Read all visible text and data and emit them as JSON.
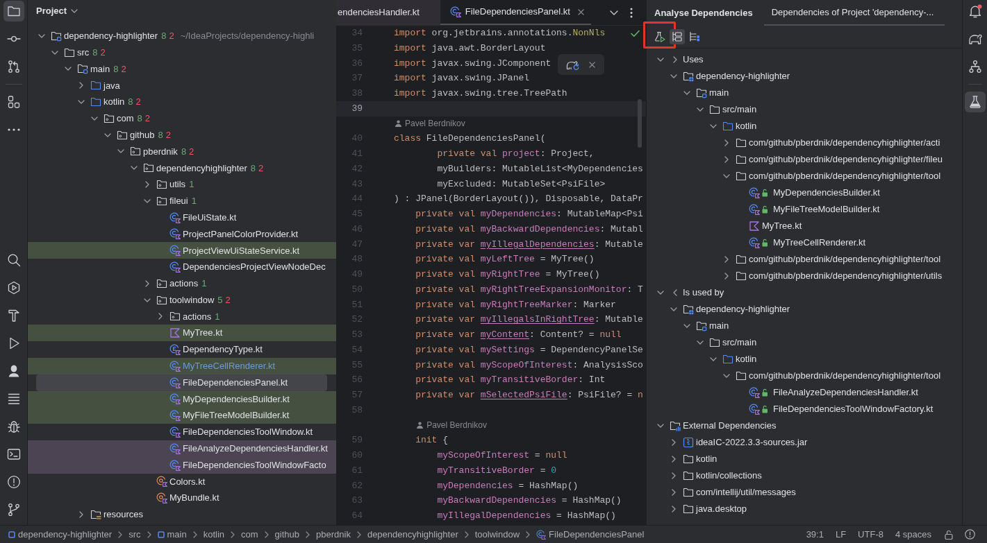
{
  "left_strip": {
    "top_groups": [
      [
        {
          "kind": "project",
          "selected": true
        },
        {
          "kind": "commit",
          "selected": false
        },
        {
          "kind": "pull_requests",
          "selected": false
        }
      ],
      [
        {
          "kind": "structure",
          "selected": false
        },
        {
          "kind": "more",
          "selected": false
        }
      ]
    ],
    "bottom": [
      {
        "kind": "search",
        "selected": false
      },
      {
        "kind": "services",
        "selected": false
      },
      {
        "kind": "build",
        "selected": false
      },
      {
        "kind": "run",
        "selected": false
      },
      {
        "kind": "bust",
        "selected": false
      },
      {
        "kind": "todo",
        "selected": false
      },
      {
        "kind": "debug",
        "selected": false
      },
      {
        "kind": "terminal",
        "selected": false
      },
      {
        "kind": "problems",
        "selected": false
      },
      {
        "kind": "git",
        "selected": false
      }
    ]
  },
  "project_panel": {
    "title": "Project",
    "tree": [
      {
        "label": "dependency-highlighter",
        "kind": "module",
        "counts": [
          {
            "value": "8",
            "color": "#6aab73"
          },
          {
            "value": "2",
            "color": "#f75464"
          }
        ],
        "path": "~/IdeaProjects/dependency-highli",
        "expanded": true,
        "selected": false,
        "modified": false,
        "children": [
          {
            "label": "src",
            "kind": "folder",
            "counts": [
              {
                "value": "8",
                "color": "#6aab73"
              },
              {
                "value": "2",
                "color": "#f75464"
              }
            ],
            "expanded": true,
            "selected": false,
            "modified": false,
            "children": [
              {
                "label": "main",
                "kind": "module",
                "counts": [
                  {
                    "value": "8",
                    "color": "#6aab73"
                  },
                  {
                    "value": "2",
                    "color": "#f75464"
                  }
                ],
                "expanded": true,
                "selected": false,
                "modified": false,
                "children": [
                  {
                    "label": "java",
                    "kind": "source_folder",
                    "expanded": false,
                    "selected": false,
                    "modified": false
                  },
                  {
                    "label": "kotlin",
                    "kind": "source_folder",
                    "counts": [
                      {
                        "value": "8",
                        "color": "#6aab73"
                      },
                      {
                        "value": "2",
                        "color": "#f75464"
                      }
                    ],
                    "expanded": true,
                    "selected": false,
                    "modified": false,
                    "children": [
                      {
                        "label": "com",
                        "kind": "package",
                        "counts": [
                          {
                            "value": "8",
                            "color": "#6aab73"
                          },
                          {
                            "value": "2",
                            "color": "#f75464"
                          }
                        ],
                        "expanded": true,
                        "selected": false,
                        "modified": false,
                        "children": [
                          {
                            "label": "github",
                            "kind": "package",
                            "counts": [
                              {
                                "value": "8",
                                "color": "#6aab73"
                              },
                              {
                                "value": "2",
                                "color": "#f75464"
                              }
                            ],
                            "expanded": true,
                            "selected": false,
                            "modified": false,
                            "children": [
                              {
                                "label": "pberdnik",
                                "kind": "package",
                                "counts": [
                                  {
                                    "value": "8",
                                    "color": "#6aab73"
                                  },
                                  {
                                    "value": "2",
                                    "color": "#f75464"
                                  }
                                ],
                                "expanded": true,
                                "selected": false,
                                "modified": false,
                                "children": [
                                  {
                                    "label": "dependencyhighlighter",
                                    "kind": "package",
                                    "counts": [
                                      {
                                        "value": "8",
                                        "color": "#6aab73"
                                      },
                                      {
                                        "value": "2",
                                        "color": "#f75464"
                                      }
                                    ],
                                    "expanded": true,
                                    "selected": false,
                                    "modified": false,
                                    "children": [
                                      {
                                        "label": "utils",
                                        "kind": "package",
                                        "counts": [
                                          {
                                            "value": "1",
                                            "color": "#6aab73"
                                          }
                                        ],
                                        "expanded": false,
                                        "selected": false,
                                        "modified": false
                                      },
                                      {
                                        "label": "fileui",
                                        "kind": "package",
                                        "counts": [
                                          {
                                            "value": "1",
                                            "color": "#6aab73"
                                          }
                                        ],
                                        "expanded": true,
                                        "selected": false,
                                        "modified": false,
                                        "children": [
                                          {
                                            "label": "FileUiState.kt",
                                            "kind": "kotlin_class",
                                            "selected": false,
                                            "modified": false
                                          },
                                          {
                                            "label": "ProjectPanelColorProvider.kt",
                                            "kind": "kotlin_class",
                                            "selected": false,
                                            "modified": false
                                          },
                                          {
                                            "label": "ProjectViewUiStateService.kt",
                                            "kind": "kotlin_class",
                                            "color": "#455040",
                                            "selected": false,
                                            "modified": false
                                          },
                                          {
                                            "label": "DependenciesProjectViewNodeDec",
                                            "kind": "kotlin_class",
                                            "selected": false,
                                            "modified": false
                                          }
                                        ]
                                      },
                                      {
                                        "label": "actions",
                                        "kind": "package",
                                        "counts": [
                                          {
                                            "value": "1",
                                            "color": "#6aab73"
                                          }
                                        ],
                                        "expanded": false,
                                        "selected": false,
                                        "modified": false
                                      },
                                      {
                                        "label": "toolwindow",
                                        "kind": "package",
                                        "counts": [
                                          {
                                            "value": "5",
                                            "color": "#6aab73"
                                          },
                                          {
                                            "value": "2",
                                            "color": "#f75464"
                                          }
                                        ],
                                        "expanded": true,
                                        "selected": false,
                                        "modified": false,
                                        "children": [
                                          {
                                            "label": "actions",
                                            "kind": "package",
                                            "counts": [
                                              {
                                                "value": "1",
                                                "color": "#6aab73"
                                              }
                                            ],
                                            "expanded": false,
                                            "selected": false,
                                            "modified": false
                                          },
                                          {
                                            "label": "MyTree.kt",
                                            "kind": "kotlin_file",
                                            "color": "#455040",
                                            "selected": false,
                                            "modified": false
                                          },
                                          {
                                            "label": "DependencyType.kt",
                                            "kind": "kotlin_enum",
                                            "selected": false,
                                            "modified": false
                                          },
                                          {
                                            "label": "MyTreeCellRenderer.kt",
                                            "kind": "kotlin_class",
                                            "color": "#455040",
                                            "selected": false,
                                            "modified": true
                                          },
                                          {
                                            "label": "FileDependenciesPanel.kt",
                                            "kind": "kotlin_class",
                                            "selected": true,
                                            "modified": false
                                          },
                                          {
                                            "label": "MyDependenciesBuilder.kt",
                                            "kind": "kotlin_class",
                                            "color": "#455040",
                                            "selected": false,
                                            "modified": false
                                          },
                                          {
                                            "label": "MyFileTreeModelBuilder.kt",
                                            "kind": "kotlin_class",
                                            "color": "#455040",
                                            "selected": false,
                                            "modified": false
                                          },
                                          {
                                            "label": "FileDependenciesToolWindow.kt",
                                            "kind": "kotlin_class",
                                            "selected": false,
                                            "modified": false
                                          },
                                          {
                                            "label": "FileAnalyzeDependenciesHandler.kt",
                                            "kind": "kotlin_class",
                                            "color": "#4d4453",
                                            "selected": false,
                                            "modified": false
                                          },
                                          {
                                            "label": "FileDependenciesToolWindowFacto",
                                            "kind": "kotlin_class",
                                            "color": "#4d4453",
                                            "selected": false,
                                            "modified": false
                                          }
                                        ]
                                      },
                                      {
                                        "label": "Colors.kt",
                                        "kind": "kotlin_object",
                                        "selected": false,
                                        "modified": false
                                      },
                                      {
                                        "label": "MyBundle.kt",
                                        "kind": "kotlin_object",
                                        "selected": false,
                                        "modified": false
                                      }
                                    ]
                                  }
                                ]
                              }
                            ]
                          }
                        ]
                      }
                    ]
                  },
                  {
                    "label": "resources",
                    "kind": "resources",
                    "expanded": false,
                    "selected": false,
                    "modified": false
                  }
                ]
              }
            ]
          }
        ]
      }
    ]
  },
  "editor": {
    "tabs": [
      {
        "label": "endenciesHandler.kt",
        "kind": "plain",
        "color": "#312d35",
        "selected": false
      },
      {
        "label": "FileDependenciesPanel.kt",
        "kind": "kotlin_class",
        "selected": true
      }
    ],
    "lines": [
      {
        "kind": "code",
        "number": "34",
        "current": false,
        "tokens": [
          {
            "text": "import",
            "kind": "keyword"
          },
          {
            "text": " org.jetbrains.annotations.",
            "kind": "plain"
          },
          {
            "text": "NonNls",
            "kind": "annotation"
          }
        ]
      },
      {
        "kind": "code",
        "number": "35",
        "current": false,
        "tokens": [
          {
            "text": "import",
            "kind": "keyword"
          },
          {
            "text": " java.awt.BorderLayout",
            "kind": "plain"
          }
        ]
      },
      {
        "kind": "code",
        "number": "36",
        "current": false,
        "tokens": [
          {
            "text": "import",
            "kind": "keyword"
          },
          {
            "text": " javax.swing.JComponent",
            "kind": "plain"
          }
        ]
      },
      {
        "kind": "code",
        "number": "37",
        "current": false,
        "tokens": [
          {
            "text": "import",
            "kind": "keyword"
          },
          {
            "text": " javax.swing.JPanel",
            "kind": "plain"
          }
        ]
      },
      {
        "kind": "code",
        "number": "38",
        "current": false,
        "tokens": [
          {
            "text": "import",
            "kind": "keyword"
          },
          {
            "text": " javax.swing.tree.TreePath",
            "kind": "plain"
          }
        ]
      },
      {
        "kind": "code",
        "number": "39",
        "current": true
      },
      {
        "kind": "author",
        "text": "Pavel Berdnikov"
      },
      {
        "kind": "code",
        "number": "40",
        "current": false,
        "tokens": [
          {
            "text": "class",
            "kind": "keyword"
          },
          {
            "text": " FileDependenciesPanel(",
            "kind": "plain"
          }
        ]
      },
      {
        "kind": "code",
        "number": "41",
        "current": false,
        "tokens": [
          {
            "text": "        private val ",
            "kind": "keyword"
          },
          {
            "text": "project",
            "kind": "property"
          },
          {
            "text": ": Project,",
            "kind": "plain"
          }
        ]
      },
      {
        "kind": "code",
        "number": "42",
        "current": false,
        "tokens": [
          {
            "text": "        myBuilders: MutableList<MyDependencies",
            "kind": "plain"
          }
        ]
      },
      {
        "kind": "code",
        "number": "43",
        "current": false,
        "tokens": [
          {
            "text": "        myExcluded: MutableSet<PsiFile>",
            "kind": "plain"
          }
        ]
      },
      {
        "kind": "code",
        "number": "44",
        "current": false,
        "tokens": [
          {
            "text": ") : JPanel(BorderLayout()), Disposable, DataPr",
            "kind": "plain"
          }
        ]
      },
      {
        "kind": "code",
        "number": "45",
        "current": false,
        "tokens": [
          {
            "text": "    private val ",
            "kind": "keyword"
          },
          {
            "text": "myDependencies",
            "kind": "property"
          },
          {
            "text": ": MutableMap<Psi",
            "kind": "plain"
          }
        ]
      },
      {
        "kind": "code",
        "number": "46",
        "current": false,
        "tokens": [
          {
            "text": "    private val ",
            "kind": "keyword"
          },
          {
            "text": "myBackwardDependencies",
            "kind": "property"
          },
          {
            "text": ": Mutabl",
            "kind": "plain"
          }
        ]
      },
      {
        "kind": "code",
        "number": "47",
        "current": false,
        "tokens": [
          {
            "text": "    private var ",
            "kind": "keyword"
          },
          {
            "text": "myIllegalDependencies",
            "kind": "mutable_property"
          },
          {
            "text": ": Mutable",
            "kind": "plain"
          }
        ]
      },
      {
        "kind": "code",
        "number": "48",
        "current": false,
        "tokens": [
          {
            "text": "    private val ",
            "kind": "keyword"
          },
          {
            "text": "myLeftTree",
            "kind": "property"
          },
          {
            "text": " = MyTree()",
            "kind": "plain"
          }
        ]
      },
      {
        "kind": "code",
        "number": "49",
        "current": false,
        "tokens": [
          {
            "text": "    private val ",
            "kind": "keyword"
          },
          {
            "text": "myRightTree",
            "kind": "property"
          },
          {
            "text": " = MyTree()",
            "kind": "plain"
          }
        ]
      },
      {
        "kind": "code",
        "number": "50",
        "current": false,
        "tokens": [
          {
            "text": "    private val ",
            "kind": "keyword"
          },
          {
            "text": "myRightTreeExpansionMonitor",
            "kind": "property"
          },
          {
            "text": ": T",
            "kind": "plain"
          }
        ]
      },
      {
        "kind": "code",
        "number": "51",
        "current": false,
        "tokens": [
          {
            "text": "    private val ",
            "kind": "keyword"
          },
          {
            "text": "myRightTreeMarker",
            "kind": "property"
          },
          {
            "text": ": Marker",
            "kind": "plain"
          }
        ]
      },
      {
        "kind": "code",
        "number": "52",
        "current": false,
        "tokens": [
          {
            "text": "    private var ",
            "kind": "keyword"
          },
          {
            "text": "myIllegalsInRightTree",
            "kind": "mutable_property"
          },
          {
            "text": ": Mutable",
            "kind": "plain"
          }
        ]
      },
      {
        "kind": "code",
        "number": "53",
        "current": false,
        "tokens": [
          {
            "text": "    private var ",
            "kind": "keyword"
          },
          {
            "text": "myContent",
            "kind": "mutable_property"
          },
          {
            "text": ": Content? = ",
            "kind": "plain"
          },
          {
            "text": "null",
            "kind": "keyword"
          }
        ]
      },
      {
        "kind": "code",
        "number": "54",
        "current": false,
        "tokens": [
          {
            "text": "    private val ",
            "kind": "keyword"
          },
          {
            "text": "mySettings",
            "kind": "property"
          },
          {
            "text": " = DependencyPanelSe",
            "kind": "plain"
          }
        ]
      },
      {
        "kind": "code",
        "number": "55",
        "current": false,
        "tokens": [
          {
            "text": "    private val ",
            "kind": "keyword"
          },
          {
            "text": "myScopeOfInterest",
            "kind": "property"
          },
          {
            "text": ": AnalysisSco",
            "kind": "plain"
          }
        ]
      },
      {
        "kind": "code",
        "number": "56",
        "current": false,
        "tokens": [
          {
            "text": "    private val ",
            "kind": "keyword"
          },
          {
            "text": "myTransitiveBorder",
            "kind": "property"
          },
          {
            "text": ": Int",
            "kind": "plain"
          }
        ]
      },
      {
        "kind": "code",
        "number": "57",
        "current": false,
        "tokens": [
          {
            "text": "    private var ",
            "kind": "keyword"
          },
          {
            "text": "mSelectedPsiFile",
            "kind": "mutable_property"
          },
          {
            "text": ": PsiFile? = ",
            "kind": "plain"
          },
          {
            "text": "n",
            "kind": "keyword"
          }
        ]
      },
      {
        "kind": "code",
        "number": "58",
        "current": false
      },
      {
        "kind": "author",
        "text": "Pavel Berdnikov"
      },
      {
        "kind": "code",
        "number": "59",
        "current": false,
        "tokens": [
          {
            "text": "    init",
            "kind": "keyword"
          },
          {
            "text": " {",
            "kind": "plain"
          }
        ]
      },
      {
        "kind": "code",
        "number": "60",
        "current": false,
        "tokens": [
          {
            "text": "        myScopeOfInterest",
            "kind": "property"
          },
          {
            "text": " = ",
            "kind": "plain"
          },
          {
            "text": "null",
            "kind": "keyword"
          }
        ]
      },
      {
        "kind": "code",
        "number": "61",
        "current": false,
        "tokens": [
          {
            "text": "        myTransitiveBorder",
            "kind": "property"
          },
          {
            "text": " = ",
            "kind": "plain"
          },
          {
            "text": "0",
            "kind": "number"
          }
        ]
      },
      {
        "kind": "code",
        "number": "62",
        "current": false,
        "tokens": [
          {
            "text": "        myDependencies",
            "kind": "property"
          },
          {
            "text": " = HashMap()",
            "kind": "plain"
          }
        ]
      },
      {
        "kind": "code",
        "number": "63",
        "current": false,
        "tokens": [
          {
            "text": "        myBackwardDependencies",
            "kind": "property"
          },
          {
            "text": " = HashMap()",
            "kind": "plain"
          }
        ]
      },
      {
        "kind": "code",
        "number": "64",
        "current": false,
        "tokens": [
          {
            "text": "        myIllegalDependencies",
            "kind": "property"
          },
          {
            "text": " = HashMap()",
            "kind": "plain"
          }
        ]
      }
    ]
  },
  "analysis_panel": {
    "title": "Analyse Dependencies",
    "tabs": [
      {
        "label": "Dependencies of Project 'dependency-...",
        "selected": true
      }
    ],
    "toolbar": [
      {
        "kind": "run",
        "pressed": false,
        "annotated": true
      },
      {
        "kind": "tree",
        "pressed": true,
        "annotated": false
      },
      {
        "kind": "tree_marked",
        "pressed": false,
        "annotated": false
      }
    ],
    "tree": [
      {
        "label": "Uses",
        "kind": "outgoing",
        "expanded": true,
        "selected": false,
        "children": [
          {
            "label": "dependency-highlighter",
            "kind": "project",
            "expanded": true,
            "selected": false,
            "children": [
              {
                "label": "main",
                "kind": "module",
                "expanded": true,
                "selected": false,
                "children": [
                  {
                    "label": "src/main",
                    "kind": "folder",
                    "expanded": true,
                    "selected": false,
                    "children": [
                      {
                        "label": "kotlin",
                        "kind": "source_folder",
                        "expanded": true,
                        "selected": false,
                        "children": [
                          {
                            "label": "com/github/pberdnik/dependencyhighlighter/acti",
                            "kind": "folder",
                            "expanded": false,
                            "selected": false
                          },
                          {
                            "label": "com/github/pberdnik/dependencyhighlighter/fileu",
                            "kind": "folder",
                            "expanded": false,
                            "selected": false
                          },
                          {
                            "label": "com/github/pberdnik/dependencyhighlighter/tool",
                            "kind": "folder",
                            "expanded": true,
                            "selected": false,
                            "children": [
                              {
                                "label": "MyDependenciesBuilder.kt",
                                "kind": "public_class",
                                "selected": false
                              },
                              {
                                "label": "MyFileTreeModelBuilder.kt",
                                "kind": "public_class",
                                "selected": false
                              },
                              {
                                "label": "MyTree.kt",
                                "kind": "kotlin_file",
                                "selected": false
                              },
                              {
                                "label": "MyTreeCellRenderer.kt",
                                "kind": "public_class",
                                "selected": false
                              }
                            ]
                          },
                          {
                            "label": "com/github/pberdnik/dependencyhighlighter/tool",
                            "kind": "folder",
                            "expanded": false,
                            "selected": false
                          },
                          {
                            "label": "com/github/pberdnik/dependencyhighlighter/utils",
                            "kind": "folder",
                            "expanded": false,
                            "selected": false
                          }
                        ]
                      }
                    ]
                  }
                ]
              }
            ]
          }
        ]
      },
      {
        "label": "Is used by",
        "kind": "incoming",
        "expanded": true,
        "selected": false,
        "children": [
          {
            "label": "dependency-highlighter",
            "kind": "project",
            "expanded": true,
            "selected": false,
            "children": [
              {
                "label": "main",
                "kind": "module",
                "expanded": true,
                "selected": false,
                "children": [
                  {
                    "label": "src/main",
                    "kind": "folder",
                    "expanded": true,
                    "selected": false,
                    "children": [
                      {
                        "label": "kotlin",
                        "kind": "source_folder",
                        "expanded": true,
                        "selected": false,
                        "children": [
                          {
                            "label": "com/github/pberdnik/dependencyhighlighter/tool",
                            "kind": "folder",
                            "expanded": true,
                            "selected": false,
                            "children": [
                              {
                                "label": "FileAnalyzeDependenciesHandler.kt",
                                "kind": "public_class",
                                "selected": false
                              },
                              {
                                "label": "FileDependenciesToolWindowFactory.kt",
                                "kind": "public_class",
                                "selected": false
                              }
                            ]
                          }
                        ]
                      }
                    ]
                  }
                ]
              }
            ]
          }
        ]
      },
      {
        "label": "External Dependencies",
        "kind": "library",
        "expanded": true,
        "selected": false,
        "children": [
          {
            "label": "ideaIC-2022.3.3-sources.jar",
            "kind": "jar",
            "expanded": false,
            "selected": false
          },
          {
            "label": "kotlin",
            "kind": "folder",
            "expanded": false,
            "selected": false
          },
          {
            "label": "kotlin/collections",
            "kind": "folder",
            "expanded": false,
            "selected": false
          },
          {
            "label": "com/intellij/util/messages",
            "kind": "folder",
            "expanded": false,
            "selected": false
          },
          {
            "label": "java.desktop",
            "kind": "folder",
            "expanded": false,
            "selected": false
          }
        ]
      }
    ]
  },
  "right_strip": {
    "top_groups": [
      [
        {
          "kind": "bell",
          "selected": false,
          "badge": true
        },
        {
          "kind": "elephant",
          "selected": false,
          "badge": false
        },
        {
          "kind": "hierarchy",
          "selected": false,
          "badge": false
        }
      ],
      [
        {
          "kind": "flask",
          "selected": true,
          "badge": false
        }
      ]
    ]
  },
  "status_bar": {
    "breadcrumbs": [
      {
        "label": "dependency-highlighter",
        "kind": "module"
      },
      {
        "label": "src",
        "kind": "plain"
      },
      {
        "label": "main",
        "kind": "module"
      },
      {
        "label": "kotlin",
        "kind": "plain"
      },
      {
        "label": "com",
        "kind": "plain"
      },
      {
        "label": "github",
        "kind": "plain"
      },
      {
        "label": "pberdnik",
        "kind": "plain"
      },
      {
        "label": "dependencyhighlighter",
        "kind": "plain"
      },
      {
        "label": "toolwindow",
        "kind": "plain"
      },
      {
        "label": "FileDependenciesPanel",
        "kind": "kotlin_class"
      }
    ],
    "caret": "39:1",
    "line_separator": "LF",
    "encoding": "UTF-8",
    "indent": "4 spaces"
  }
}
